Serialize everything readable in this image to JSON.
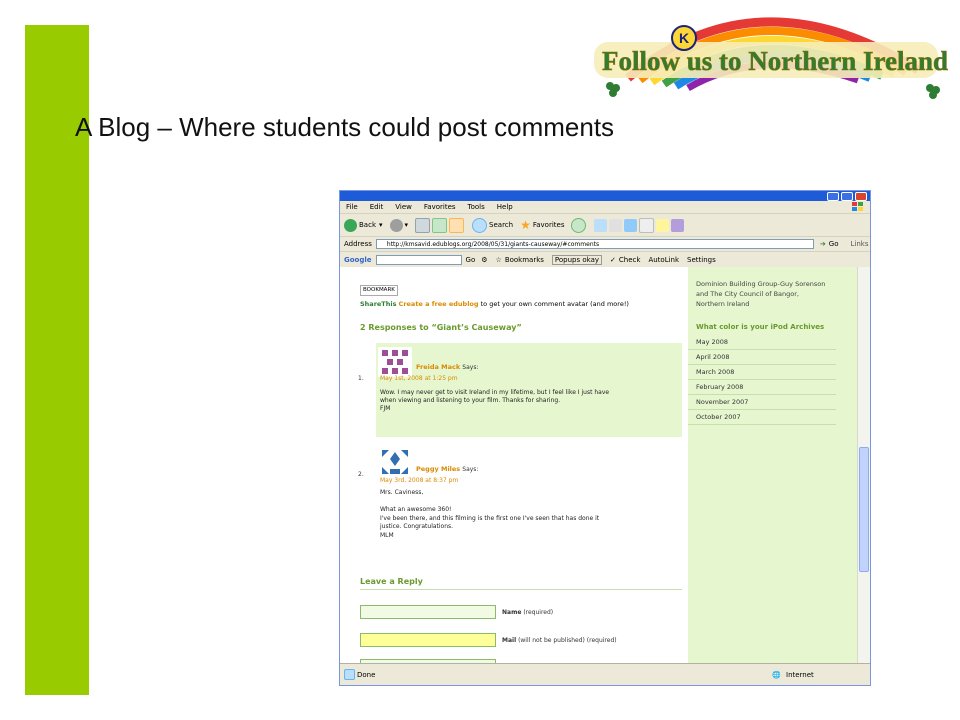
{
  "slide": {
    "title": "A Blog – Where students could post comments",
    "logo_text": "Follow us to Northern Ireland",
    "logo_badge": "K"
  },
  "colors": {
    "accent_bar": "#99cc00",
    "xp_title_blue": "#1e5bd8",
    "comment_bg": "#e6f6cf",
    "link_orange": "#d98a00",
    "heading_green": "#6a9a2e"
  },
  "browser": {
    "menu": [
      "File",
      "Edit",
      "View",
      "Favorites",
      "Tools",
      "Help"
    ],
    "toolbar": {
      "back": "Back",
      "search": "Search",
      "favorites": "Favorites"
    },
    "address_label": "Address",
    "url": "http://kmsavid.edublogs.org/2008/05/31/giants-causeway/#comments",
    "go": "Go",
    "links": "Links",
    "google": {
      "brand": "Google",
      "go": "Go",
      "bookmarks": "Bookmarks",
      "popups": "Popups okay",
      "check": "Check",
      "autolink": "AutoLink",
      "settings": "Settings"
    },
    "status": {
      "left": "Done",
      "right": "Internet"
    }
  },
  "blog": {
    "bookmark_label": "BOOKMARK",
    "sharethis_label": "ShareThis",
    "share_link": "Create a free edublog",
    "share_text": "to get your own comment avatar (and more!)",
    "responses_heading": "2 Responses to “Giant’s Causeway”",
    "comments": [
      {
        "num": "1.",
        "author": "Freida Mack",
        "says": "Says:",
        "date": "May 1st, 2008 at 1:25 pm",
        "lines": [
          "Wow. I may never get to visit Ireland in my lifetime, but I feel like I just have",
          "when viewing and listening to your film. Thanks for sharing.",
          "FJM"
        ]
      },
      {
        "num": "2.",
        "author": "Peggy Miles",
        "says": "Says:",
        "date": "May 3rd, 2008 at 8:37 pm",
        "lines": [
          "Mrs. Caviness,",
          "",
          "What an awesome 360!",
          "I've been there, and this filming is the first one I've seen that has done it",
          "justice. Congratulations.",
          "MLM"
        ]
      }
    ],
    "leave_reply": "Leave a Reply",
    "form": {
      "name_label": "Name",
      "name_hint": "(required)",
      "mail_label": "Mail",
      "mail_hint": "(will not be published) (required)"
    }
  },
  "sidebar": {
    "intro_lines": [
      "Dominion Building Group-Guy Sorenson",
      "and The City Council of Bangor,",
      "Northern Ireland"
    ],
    "archives_heading": "What color is your iPod Archives",
    "archives": [
      "May 2008",
      "April 2008",
      "March 2008",
      "February 2008",
      "November 2007",
      "October 2007"
    ]
  }
}
